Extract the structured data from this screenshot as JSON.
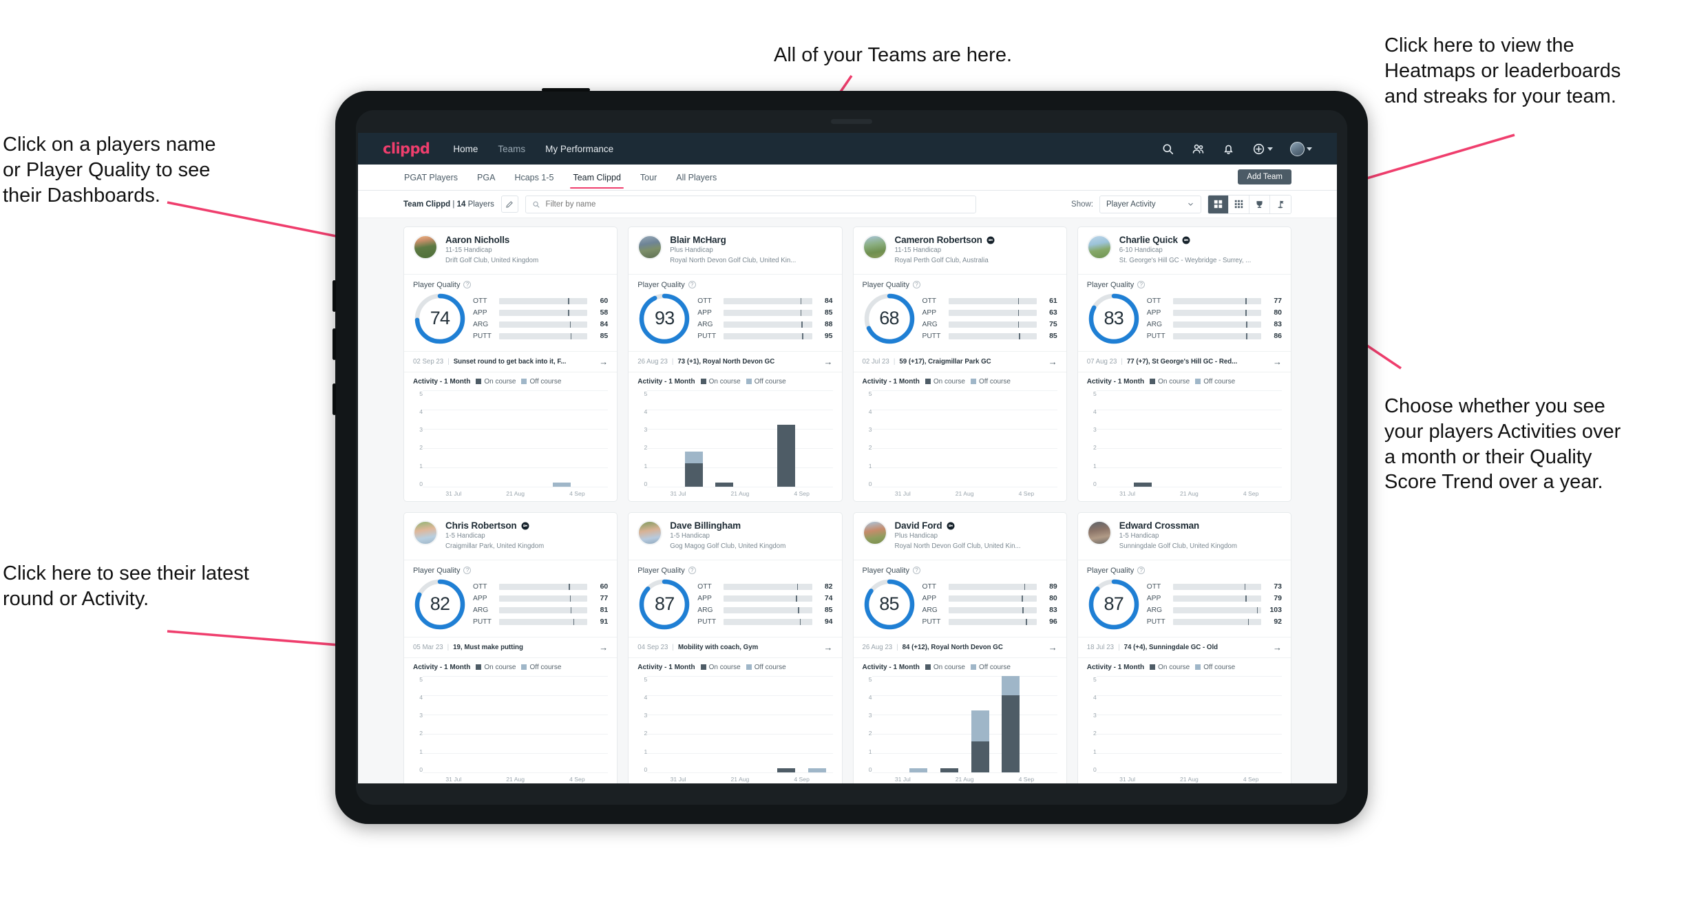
{
  "annotations": [
    {
      "id": "teams",
      "text": "All of your Teams are here."
    },
    {
      "id": "heatmaps",
      "text": "Click here to view the\nHeatmaps or leaderboards\nand streaks for your team."
    },
    {
      "id": "player-name",
      "text": "Click on a players name\nor Player Quality to see\ntheir Dashboards."
    },
    {
      "id": "activity-choice",
      "text": "Choose whether you see\nyour players Activities over\na month or their Quality\nScore Trend over a year."
    },
    {
      "id": "latest-round",
      "text": "Click here to see their latest\nround or Activity."
    }
  ],
  "app": {
    "brand": "clippd",
    "nav_links": [
      {
        "label": "Home",
        "active": true
      },
      {
        "label": "Teams",
        "active": false
      },
      {
        "label": "My Performance",
        "active": true
      }
    ],
    "nav_icons": [
      "search-icon",
      "people-icon",
      "bell-icon",
      "plus-circle-icon",
      "avatar"
    ],
    "tabs": [
      {
        "label": "PGAT Players",
        "active": false
      },
      {
        "label": "PGA",
        "active": false
      },
      {
        "label": "Hcaps 1-5",
        "active": false
      },
      {
        "label": "Team Clippd",
        "active": true
      },
      {
        "label": "Tour",
        "active": false
      },
      {
        "label": "All Players",
        "active": false
      }
    ],
    "add_team_label": "Add Team",
    "toolbar": {
      "team_name": "Team Clippd",
      "team_separator": "|",
      "player_count": "14",
      "players_word": "Players",
      "edit_icon": "pencil-icon",
      "search_placeholder": "Filter by name",
      "search_value": "",
      "show_label": "Show:",
      "show_value": "Player Activity",
      "view_toggles": [
        {
          "icon": "grid-large-icon",
          "active": true
        },
        {
          "icon": "grid-small-icon",
          "active": false
        },
        {
          "icon": "trophy-icon",
          "active": false
        },
        {
          "icon": "flag-icon",
          "active": false
        }
      ]
    },
    "labels": {
      "player_quality": "Player Quality",
      "activity_title": "Activity - 1 Month",
      "legend_on": "On course",
      "legend_off": "Off course",
      "help_glyph": "?",
      "arrow_glyph": "→"
    },
    "colors": {
      "brand_pink": "#ef3e6d",
      "nav_dark": "#1c2b36",
      "ring_blue": "#1f7fd4",
      "ott": "#f8b316",
      "app": "#3ddbb0",
      "arg": "#f5114f",
      "putt": "#b210d6",
      "on_course": "#4e5c66",
      "off_course": "#9fb6c8"
    },
    "skill_keys": [
      "OTT",
      "APP",
      "ARG",
      "PUTT"
    ],
    "chart_axis": {
      "y_ticks": [
        "5",
        "4",
        "3",
        "2",
        "1",
        "0"
      ],
      "x_ticks": [
        "31 Jul",
        "21 Aug",
        "4 Sep"
      ],
      "ymax": 5
    }
  },
  "players": [
    {
      "name": "Aaron Nicholls",
      "verified": false,
      "handicap": "11-15 Handicap",
      "club": "Drift Golf Club, United Kingdom",
      "quality": 74,
      "skills": [
        {
          "key": "OTT",
          "value": 60,
          "fill_pct": 57,
          "tick_pct": 78
        },
        {
          "key": "APP",
          "value": 58,
          "fill_pct": 55,
          "tick_pct": 78
        },
        {
          "key": "ARG",
          "value": 84,
          "fill_pct": 74,
          "tick_pct": 80
        },
        {
          "key": "PUTT",
          "value": 85,
          "fill_pct": 75,
          "tick_pct": 81
        }
      ],
      "latest_date": "02 Sep 23",
      "latest_text": "Sunset round to get back into it, F...",
      "activity": [
        {
          "on": 0,
          "off": 0
        },
        {
          "on": 0,
          "off": 0
        },
        {
          "on": 0,
          "off": 0
        },
        {
          "on": 0,
          "off": 0
        },
        {
          "on": 0,
          "off": 1
        },
        {
          "on": 0,
          "off": 0
        }
      ],
      "avatar_css": "linear-gradient(170deg,#f0b584 0%,#c98f6a 22%,#5d7a44 50%,#4e6e38 100%)"
    },
    {
      "name": "Blair McHarg",
      "verified": false,
      "handicap": "Plus Handicap",
      "club": "Royal North Devon Golf Club, United Kin...",
      "quality": 93,
      "skills": [
        {
          "key": "OTT",
          "value": 84,
          "fill_pct": 80,
          "tick_pct": 87
        },
        {
          "key": "APP",
          "value": 85,
          "fill_pct": 81,
          "tick_pct": 87
        },
        {
          "key": "ARG",
          "value": 88,
          "fill_pct": 82,
          "tick_pct": 88
        },
        {
          "key": "PUTT",
          "value": 95,
          "fill_pct": 86,
          "tick_pct": 89
        }
      ],
      "latest_date": "26 Aug 23",
      "latest_text": "73 (+1), Royal North Devon GC",
      "activity": [
        {
          "on": 0,
          "off": 0
        },
        {
          "on": 2,
          "off": 1
        },
        {
          "on": 1,
          "off": 0
        },
        {
          "on": 0,
          "off": 0
        },
        {
          "on": 4,
          "off": 0
        },
        {
          "on": 0,
          "off": 0
        }
      ],
      "avatar_css": "linear-gradient(170deg,#97a9b8 0%,#6e8496 35%,#7d8f6a 60%,#5d6f52 100%)"
    },
    {
      "name": "Cameron Robertson",
      "verified": true,
      "handicap": "11-15 Handicap",
      "club": "Royal Perth Golf Club, Australia",
      "quality": 68,
      "skills": [
        {
          "key": "OTT",
          "value": 61,
          "fill_pct": 58,
          "tick_pct": 79
        },
        {
          "key": "APP",
          "value": 63,
          "fill_pct": 59,
          "tick_pct": 79
        },
        {
          "key": "ARG",
          "value": 75,
          "fill_pct": 68,
          "tick_pct": 79
        },
        {
          "key": "PUTT",
          "value": 85,
          "fill_pct": 75,
          "tick_pct": 80
        }
      ],
      "latest_date": "02 Jul 23",
      "latest_text": "59 (+17), Craigmillar Park GC",
      "activity": [
        {
          "on": 0,
          "off": 0
        },
        {
          "on": 0,
          "off": 0
        },
        {
          "on": 0,
          "off": 0
        },
        {
          "on": 0,
          "off": 0
        },
        {
          "on": 0,
          "off": 0
        },
        {
          "on": 0,
          "off": 0
        }
      ],
      "avatar_css": "linear-gradient(170deg,#a8c5d8 0%,#89ad7e 40%,#6f8f4f 70%,#8a9a5b 100%)"
    },
    {
      "name": "Charlie Quick",
      "verified": true,
      "handicap": "6-10 Handicap",
      "club": "St. George's Hill GC - Weybridge - Surrey, ...",
      "quality": 83,
      "skills": [
        {
          "key": "OTT",
          "value": 77,
          "fill_pct": 70,
          "tick_pct": 82
        },
        {
          "key": "APP",
          "value": 80,
          "fill_pct": 72,
          "tick_pct": 82
        },
        {
          "key": "ARG",
          "value": 83,
          "fill_pct": 74,
          "tick_pct": 83
        },
        {
          "key": "PUTT",
          "value": 86,
          "fill_pct": 76,
          "tick_pct": 83
        }
      ],
      "latest_date": "07 Aug 23",
      "latest_text": "77 (+7), St George's Hill GC - Red...",
      "activity": [
        {
          "on": 0,
          "off": 0
        },
        {
          "on": 1,
          "off": 0
        },
        {
          "on": 0,
          "off": 0
        },
        {
          "on": 0,
          "off": 0
        },
        {
          "on": 0,
          "off": 0
        },
        {
          "on": 0,
          "off": 0
        }
      ],
      "avatar_css": "linear-gradient(170deg,#bcd6ea 0%,#9cc3d9 35%,#86a86a 62%,#6f9451 100%)"
    },
    {
      "name": "Chris Robertson",
      "verified": true,
      "handicap": "1-5 Handicap",
      "club": "Craigmillar Park, United Kingdom",
      "quality": 82,
      "skills": [
        {
          "key": "OTT",
          "value": 60,
          "fill_pct": 57,
          "tick_pct": 79
        },
        {
          "key": "APP",
          "value": 77,
          "fill_pct": 71,
          "tick_pct": 80
        },
        {
          "key": "ARG",
          "value": 81,
          "fill_pct": 73,
          "tick_pct": 81
        },
        {
          "key": "PUTT",
          "value": 91,
          "fill_pct": 80,
          "tick_pct": 84
        }
      ],
      "latest_date": "05 Mar 23",
      "latest_text": "19, Must make putting",
      "activity": [
        {
          "on": 0,
          "off": 0
        },
        {
          "on": 0,
          "off": 0
        },
        {
          "on": 0,
          "off": 0
        },
        {
          "on": 0,
          "off": 0
        },
        {
          "on": 0,
          "off": 0
        },
        {
          "on": 0,
          "off": 0
        }
      ],
      "avatar_css": "linear-gradient(170deg,#8fb474 0%,#e0b79a 38%,#b8cfe0 70%,#9fb6c8 100%)"
    },
    {
      "name": "Dave Billingham",
      "verified": false,
      "handicap": "1-5 Handicap",
      "club": "Gog Magog Golf Club, United Kingdom",
      "quality": 87,
      "skills": [
        {
          "key": "OTT",
          "value": 82,
          "fill_pct": 74,
          "tick_pct": 83
        },
        {
          "key": "APP",
          "value": 74,
          "fill_pct": 68,
          "tick_pct": 82
        },
        {
          "key": "ARG",
          "value": 85,
          "fill_pct": 76,
          "tick_pct": 84
        },
        {
          "key": "PUTT",
          "value": 94,
          "fill_pct": 83,
          "tick_pct": 86
        }
      ],
      "latest_date": "04 Sep 23",
      "latest_text": "Mobility with coach, Gym",
      "activity": [
        {
          "on": 0,
          "off": 0
        },
        {
          "on": 0,
          "off": 0
        },
        {
          "on": 0,
          "off": 0
        },
        {
          "on": 0,
          "off": 0
        },
        {
          "on": 1,
          "off": 0
        },
        {
          "on": 0,
          "off": 1
        }
      ],
      "avatar_css": "linear-gradient(170deg,#7e9b5e 0%,#d8b295 40%,#b7cade 72%,#8fa8bd 100%)"
    },
    {
      "name": "David Ford",
      "verified": true,
      "handicap": "Plus Handicap",
      "club": "Royal North Devon Golf Club, United Kin...",
      "quality": 85,
      "skills": [
        {
          "key": "OTT",
          "value": 89,
          "fill_pct": 82,
          "tick_pct": 86
        },
        {
          "key": "APP",
          "value": 80,
          "fill_pct": 72,
          "tick_pct": 83
        },
        {
          "key": "ARG",
          "value": 83,
          "fill_pct": 74,
          "tick_pct": 84
        },
        {
          "key": "PUTT",
          "value": 96,
          "fill_pct": 86,
          "tick_pct": 88
        }
      ],
      "latest_date": "26 Aug 23",
      "latest_text": "84 (+12), Royal North Devon GC",
      "activity": [
        {
          "on": 0,
          "off": 0
        },
        {
          "on": 0,
          "off": 1
        },
        {
          "on": 1,
          "off": 0
        },
        {
          "on": 2,
          "off": 2
        },
        {
          "on": 4,
          "off": 1
        },
        {
          "on": 0,
          "off": 0
        }
      ],
      "avatar_css": "linear-gradient(170deg,#a9c6de 0%,#c68b6b 40%,#8e9d5e 70%,#7b8f4e 100%)"
    },
    {
      "name": "Edward Crossman",
      "verified": false,
      "handicap": "1-5 Handicap",
      "club": "Sunningdale Golf Club, United Kingdom",
      "quality": 87,
      "skills": [
        {
          "key": "OTT",
          "value": 73,
          "fill_pct": 67,
          "tick_pct": 81
        },
        {
          "key": "APP",
          "value": 79,
          "fill_pct": 71,
          "tick_pct": 82
        },
        {
          "key": "ARG",
          "value": 103,
          "fill_pct": 88,
          "tick_pct": 95
        },
        {
          "key": "PUTT",
          "value": 92,
          "fill_pct": 81,
          "tick_pct": 85
        }
      ],
      "latest_date": "18 Jul 23",
      "latest_text": "74 (+4), Sunningdale GC - Old",
      "activity": [
        {
          "on": 0,
          "off": 0
        },
        {
          "on": 0,
          "off": 0
        },
        {
          "on": 0,
          "off": 0
        },
        {
          "on": 0,
          "off": 0
        },
        {
          "on": 0,
          "off": 0
        },
        {
          "on": 0,
          "off": 0
        }
      ],
      "avatar_css": "linear-gradient(170deg,#5e646a 0%,#8b7468 38%,#b09a86 68%,#6d6a66 100%)"
    }
  ]
}
